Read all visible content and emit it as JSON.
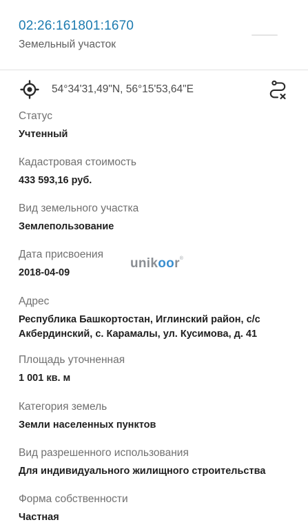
{
  "header": {
    "cadastral_number": "02:26:161801:1670",
    "subtitle": "Земельный участок"
  },
  "coordinates": {
    "text": "54°34'31,49\"N, 56°15'53,64\"E",
    "locate_icon": "gps-crosshair-icon",
    "route_icon": "route-icon"
  },
  "fields": [
    {
      "label": "Статус",
      "value": "Учтенный"
    },
    {
      "label": "Кадастровая стоимость",
      "value": "433 593,16 руб."
    },
    {
      "label": "Вид земельного участка",
      "value": "Землепользование"
    },
    {
      "label": "Дата присвоения",
      "value": "2018-04-09"
    },
    {
      "label": "Адрес",
      "value": "Республика Башкортостан, Иглинский район, с/с Акбердинский, с. Карамалы, ул. Кусимова, д. 41"
    },
    {
      "label": "Площадь уточненная",
      "value": "1 001 кв. м"
    },
    {
      "label": "Категория земель",
      "value": "Земли населенных пунктов"
    },
    {
      "label": "Вид разрешенного использования",
      "value": "Для индивидуального жилищного строительства"
    },
    {
      "label": "Форма собственности",
      "value": "Частная"
    }
  ],
  "watermark": {
    "part1": "unik",
    "part2": "oo",
    "part3": "r",
    "mark": "®"
  },
  "colors": {
    "accent": "#1c7bb0",
    "label": "#707070",
    "value": "#1f1f1f"
  }
}
